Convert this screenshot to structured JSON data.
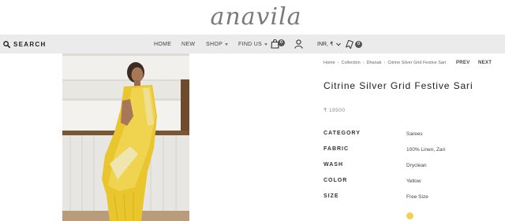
{
  "brand": {
    "logo_text": "anavila"
  },
  "nav": {
    "search_label": "SEARCH",
    "menu": [
      {
        "label": "HOME",
        "has_caret": false
      },
      {
        "label": "NEW",
        "has_caret": false
      },
      {
        "label": "SHOP",
        "has_caret": true
      },
      {
        "label": "FIND US",
        "has_caret": true
      }
    ],
    "cart_count": "0",
    "currency_label": "INR, ₹",
    "bag_count": "0"
  },
  "breadcrumb": [
    "Home",
    "Collection",
    "Dhanak",
    "Citrine Silver Grid Festive Sari"
  ],
  "pager": {
    "prev": "PREV",
    "next": "NEXT"
  },
  "product": {
    "title": "Citrine Silver Grid Festive Sari",
    "price": "₹ 19500",
    "attributes": [
      {
        "label": "CATEGORY",
        "value": "Sarees"
      },
      {
        "label": "FABRIC",
        "value": "100% Linen, Zari"
      },
      {
        "label": "WASH",
        "value": "Dryclean"
      },
      {
        "label": "COLOR",
        "value": "Yellow"
      },
      {
        "label": "SIZE",
        "value": "Free Size"
      }
    ],
    "swatch_color": "#efd255"
  },
  "colors": {
    "nav_bg": "#ebebeb",
    "sari": "#e9c62e"
  }
}
